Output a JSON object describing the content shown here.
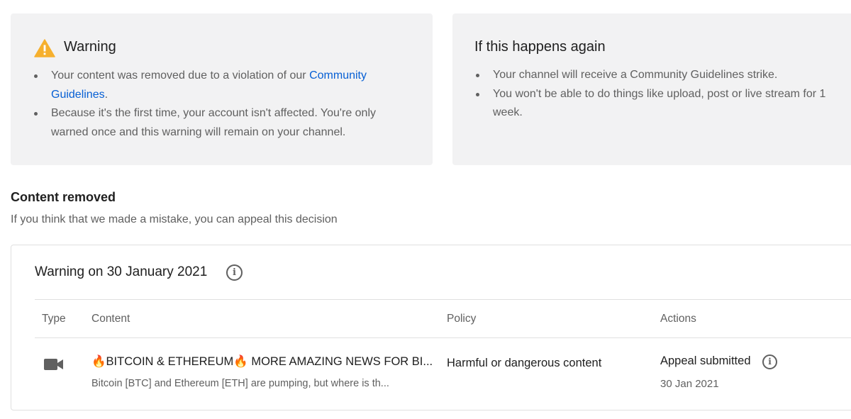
{
  "warning_card": {
    "title": "Warning",
    "bullet1_prefix": "Your content was removed due to a violation of our ",
    "bullet1_link": "Community Guidelines",
    "bullet1_suffix": ".",
    "bullet2": "Because it's the first time, your account isn't affected. You're only warned once and this warning will remain on your channel.",
    "icon": "warning-triangle-icon",
    "icon_color": "#f6b02e"
  },
  "again_card": {
    "title": "If this happens again",
    "bullet1": "Your channel will receive a Community Guidelines strike.",
    "bullet2": "You won't be able to do things like upload, post or live stream for 1 week."
  },
  "section": {
    "title": "Content removed",
    "subtitle": "If you think that we made a mistake, you can appeal this decision"
  },
  "table": {
    "title": "Warning on 30 January 2021",
    "headers": {
      "type": "Type",
      "content": "Content",
      "policy": "Policy",
      "actions": "Actions"
    },
    "rows": [
      {
        "type_icon": "video-camera-icon",
        "title": "🔥BITCOIN & ETHEREUM🔥 MORE AMAZING NEWS FOR BI...",
        "description": "Bitcoin [BTC] and Ethereum [ETH] are pumping, but where is th...",
        "policy": "Harmful or dangerous content",
        "action": "Appeal submitted",
        "date": "30 Jan 2021"
      }
    ]
  },
  "colors": {
    "link": "#065fd4",
    "card_bg": "#f2f2f3",
    "secondary_text": "#606060"
  }
}
